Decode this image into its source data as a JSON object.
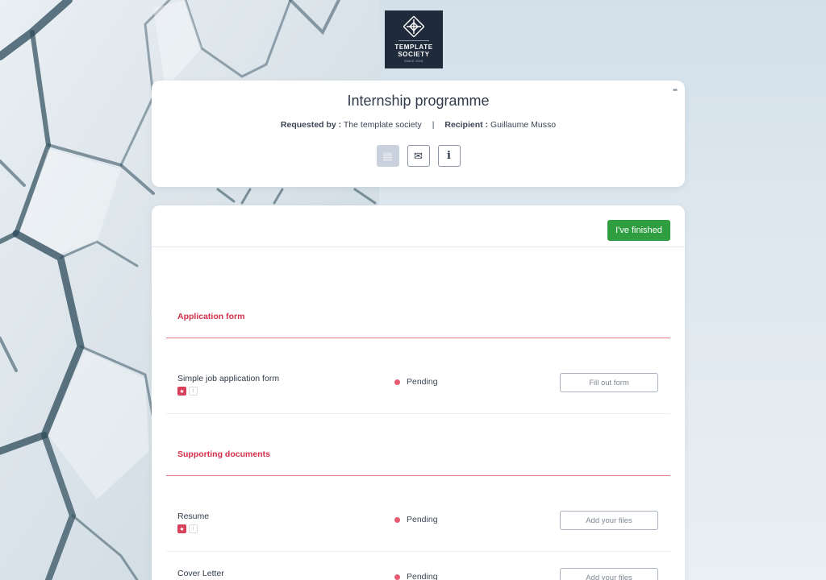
{
  "logo": {
    "line1": "TEMPLATE",
    "line2": "SOCIETY",
    "line3": "SINCE 2016"
  },
  "header": {
    "title": "Internship programme",
    "requested_by_label": "Requested by :",
    "requested_by_value": "The template society",
    "separator": "|",
    "recipient_label": "Recipient :",
    "recipient_value": "Guillaume Musso",
    "menu_glyph": "••",
    "actions": [
      {
        "icon": "document-icon",
        "glyph": "▤"
      },
      {
        "icon": "envelope-icon",
        "glyph": "✉"
      },
      {
        "icon": "info-icon",
        "glyph": "i"
      }
    ]
  },
  "main": {
    "finish_label": "I've finished",
    "sections": [
      {
        "title": "Application form",
        "items": [
          {
            "name": "Simple job application form",
            "status": "Pending",
            "action": "Fill out form"
          }
        ]
      },
      {
        "title": "Supporting documents",
        "items": [
          {
            "name": "Resume",
            "status": "Pending",
            "action": "Add your files"
          },
          {
            "name": "Cover Letter",
            "status": "Pending",
            "action": "Add your files"
          }
        ]
      }
    ]
  },
  "colors": {
    "accent_red": "#d32f4a",
    "finish_green": "#2e9e41",
    "status_dot": "#e85a72",
    "logo_bg": "#1f2a3a"
  }
}
